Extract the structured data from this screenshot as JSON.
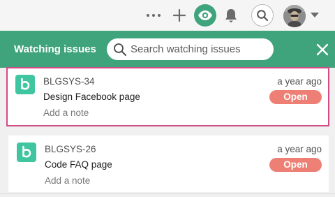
{
  "colors": {
    "accent_green": "#3fa37c",
    "project_icon": "#3fc59f",
    "status_open": "#ee7f74",
    "selection_outline": "#d24a86",
    "toolbar_bg": "#f5f5f5"
  },
  "toolbar": {
    "icons": [
      "more-icon",
      "plus-icon",
      "eye-icon",
      "bell-icon",
      "search-icon",
      "avatar",
      "caret-down-icon"
    ]
  },
  "panel": {
    "title": "Watching issues",
    "search": {
      "placeholder": "Search watching issues",
      "value": ""
    },
    "close_icon": "close-icon"
  },
  "issues": [
    {
      "key": "BLGSYS-34",
      "summary": "Design Facebook page",
      "note_label": "Add a note",
      "time": "a year ago",
      "status": "Open",
      "selected": true
    },
    {
      "key": "BLGSYS-26",
      "summary": "Code FAQ page",
      "note_label": "Add a note",
      "time": "a year ago",
      "status": "Open",
      "selected": false
    }
  ]
}
